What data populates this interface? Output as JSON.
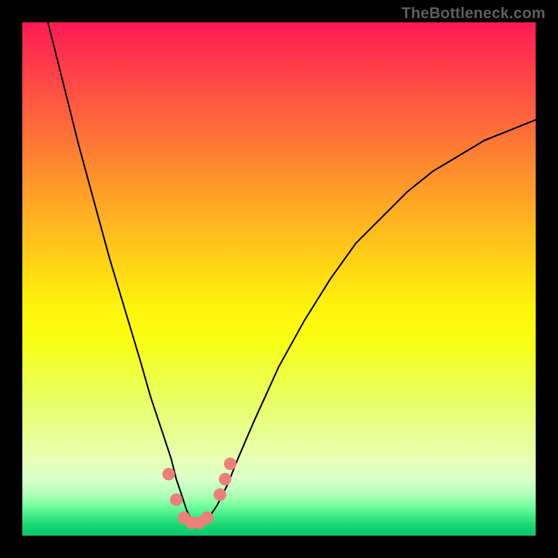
{
  "attribution": "TheBottleneck.com",
  "colors": {
    "background": "#000000",
    "marker": "#ed7f79",
    "curve": "#000000",
    "gradient_top": "#ff1a55",
    "gradient_bottom": "#0bc767"
  },
  "chart_data": {
    "type": "line",
    "title": "",
    "xlabel": "",
    "ylabel": "",
    "xlim": [
      0,
      100
    ],
    "ylim": [
      0,
      100
    ],
    "series": [
      {
        "name": "bottleneck-curve",
        "x": [
          5,
          8,
          11,
          14,
          17,
          20,
          23,
          25,
          27,
          29,
          30,
          31,
          32,
          33,
          34,
          35,
          36,
          38,
          40,
          42,
          45,
          50,
          55,
          60,
          65,
          70,
          75,
          80,
          85,
          90,
          95,
          100
        ],
        "y": [
          100,
          88,
          76,
          65,
          54,
          44,
          34,
          27,
          21,
          15,
          11,
          8,
          5,
          3,
          2,
          2,
          3,
          6,
          10,
          15,
          22,
          33,
          42,
          50,
          57,
          62,
          67,
          71,
          74,
          77,
          79,
          81
        ]
      }
    ],
    "markers": {
      "name": "bottleneck-marker-cluster",
      "points": [
        {
          "x": 28.5,
          "y": 12
        },
        {
          "x": 30.0,
          "y": 7
        },
        {
          "x": 31.5,
          "y": 3.5
        },
        {
          "x": 33.0,
          "y": 2.5
        },
        {
          "x": 34.5,
          "y": 2.5
        },
        {
          "x": 36.0,
          "y": 3.5
        },
        {
          "x": 38.5,
          "y": 8
        },
        {
          "x": 39.5,
          "y": 11
        },
        {
          "x": 40.5,
          "y": 14
        }
      ]
    }
  }
}
